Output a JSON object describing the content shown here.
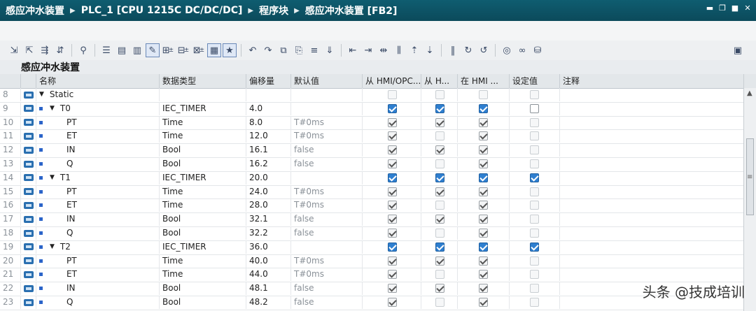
{
  "title": {
    "crumbs": [
      "感应冲水装置",
      "PLC_1 [CPU 1215C DC/DC/DC]",
      "程序块",
      "感应冲水装置 [FB2]"
    ]
  },
  "block_name": "感应冲水装置",
  "columns": [
    "名称",
    "数据类型",
    "偏移量",
    "默认值",
    "从 HMI/OPC...",
    "从 H...",
    "在 HMI ...",
    "设定值",
    "注释"
  ],
  "rows": [
    {
      "n": "8",
      "indent": 0,
      "tri": true,
      "sq": false,
      "name": "Static",
      "type": "",
      "offset": "",
      "def": "",
      "c": [
        "d",
        "d",
        "d",
        "d"
      ]
    },
    {
      "n": "9",
      "indent": 1,
      "tri": true,
      "sq": true,
      "name": "T0",
      "type": "IEC_TIMER",
      "offset": "4.0",
      "def": "",
      "c": [
        "on",
        "on",
        "on",
        "u"
      ]
    },
    {
      "n": "10",
      "indent": 2,
      "tri": false,
      "sq": true,
      "name": "PT",
      "type": "Time",
      "offset": "8.0",
      "def": "T#0ms",
      "c": [
        "g",
        "g",
        "g",
        "d"
      ]
    },
    {
      "n": "11",
      "indent": 2,
      "tri": false,
      "sq": true,
      "name": "ET",
      "type": "Time",
      "offset": "12.0",
      "def": "T#0ms",
      "c": [
        "g",
        "d",
        "g",
        "d"
      ]
    },
    {
      "n": "12",
      "indent": 2,
      "tri": false,
      "sq": true,
      "name": "IN",
      "type": "Bool",
      "offset": "16.1",
      "def": "false",
      "c": [
        "g",
        "g",
        "g",
        "d"
      ]
    },
    {
      "n": "13",
      "indent": 2,
      "tri": false,
      "sq": true,
      "name": "Q",
      "type": "Bool",
      "offset": "16.2",
      "def": "false",
      "c": [
        "g",
        "d",
        "g",
        "d"
      ]
    },
    {
      "n": "14",
      "indent": 1,
      "tri": true,
      "sq": true,
      "name": "T1",
      "type": "IEC_TIMER",
      "offset": "20.0",
      "def": "",
      "c": [
        "on",
        "on",
        "on",
        "on"
      ]
    },
    {
      "n": "15",
      "indent": 2,
      "tri": false,
      "sq": true,
      "name": "PT",
      "type": "Time",
      "offset": "24.0",
      "def": "T#0ms",
      "c": [
        "g",
        "g",
        "g",
        "d"
      ]
    },
    {
      "n": "16",
      "indent": 2,
      "tri": false,
      "sq": true,
      "name": "ET",
      "type": "Time",
      "offset": "28.0",
      "def": "T#0ms",
      "c": [
        "g",
        "d",
        "g",
        "d"
      ]
    },
    {
      "n": "17",
      "indent": 2,
      "tri": false,
      "sq": true,
      "name": "IN",
      "type": "Bool",
      "offset": "32.1",
      "def": "false",
      "c": [
        "g",
        "g",
        "g",
        "d"
      ]
    },
    {
      "n": "18",
      "indent": 2,
      "tri": false,
      "sq": true,
      "name": "Q",
      "type": "Bool",
      "offset": "32.2",
      "def": "false",
      "c": [
        "g",
        "d",
        "g",
        "d"
      ]
    },
    {
      "n": "19",
      "indent": 1,
      "tri": true,
      "sq": true,
      "name": "T2",
      "type": "IEC_TIMER",
      "offset": "36.0",
      "def": "",
      "c": [
        "on",
        "on",
        "on",
        "on"
      ]
    },
    {
      "n": "20",
      "indent": 2,
      "tri": false,
      "sq": true,
      "name": "PT",
      "type": "Time",
      "offset": "40.0",
      "def": "T#0ms",
      "c": [
        "g",
        "g",
        "g",
        "d"
      ]
    },
    {
      "n": "21",
      "indent": 2,
      "tri": false,
      "sq": true,
      "name": "ET",
      "type": "Time",
      "offset": "44.0",
      "def": "T#0ms",
      "c": [
        "g",
        "d",
        "g",
        "d"
      ]
    },
    {
      "n": "22",
      "indent": 2,
      "tri": false,
      "sq": true,
      "name": "IN",
      "type": "Bool",
      "offset": "48.1",
      "def": "false",
      "c": [
        "g",
        "g",
        "g",
        "d"
      ]
    },
    {
      "n": "23",
      "indent": 2,
      "tri": false,
      "sq": true,
      "name": "Q",
      "type": "Bool",
      "offset": "48.2",
      "def": "false",
      "c": [
        "g",
        "d",
        "g",
        "d"
      ]
    }
  ],
  "watermark": "头条 @技成培训"
}
